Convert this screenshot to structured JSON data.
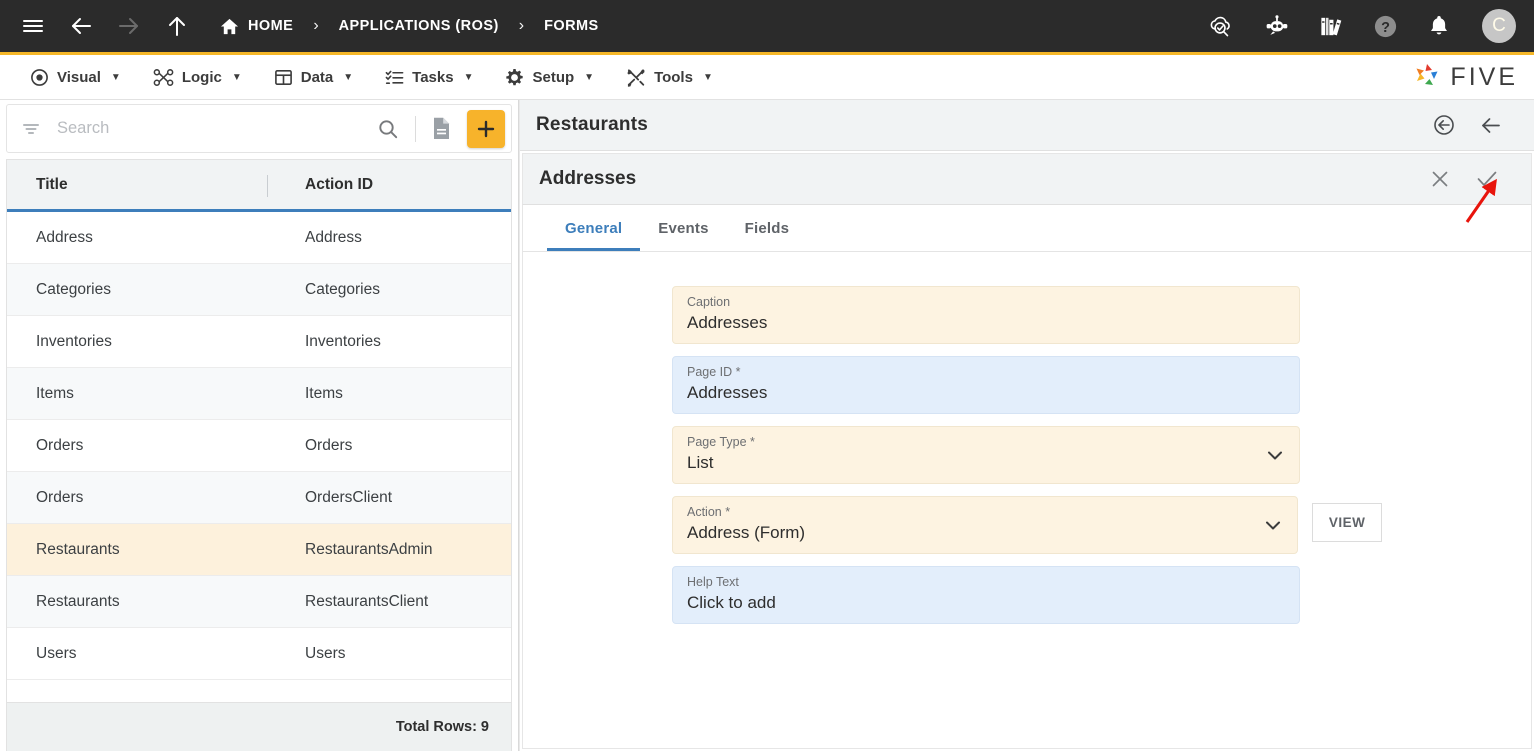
{
  "topbar": {
    "menu_icon": "hamburger-icon",
    "back_icon": "arrow-left-icon",
    "forward_icon": "arrow-right-icon",
    "up_icon": "arrow-up-icon",
    "breadcrumb": [
      {
        "label": "HOME",
        "icon": "home-icon"
      },
      {
        "label": "APPLICATIONS (ROS)",
        "icon": ""
      },
      {
        "label": "FORMS",
        "icon": ""
      }
    ],
    "separator": "›",
    "right_icons": [
      {
        "name": "cloud-check-search-icon"
      },
      {
        "name": "robot-chat-icon"
      },
      {
        "name": "books-library-icon"
      },
      {
        "name": "help-icon"
      },
      {
        "name": "notifications-bell-icon"
      }
    ],
    "avatar_letter": "C",
    "accent_color": "#f5b728",
    "background_color": "#2b2b2b"
  },
  "menubar": {
    "items": [
      {
        "label": "Visual",
        "icon": "eye-icon"
      },
      {
        "label": "Logic",
        "icon": "flow-nodes-icon"
      },
      {
        "label": "Data",
        "icon": "table-grid-icon"
      },
      {
        "label": "Tasks",
        "icon": "task-list-icon"
      },
      {
        "label": "Setup",
        "icon": "gear-icon"
      },
      {
        "label": "Tools",
        "icon": "tools-crossed-icon"
      }
    ],
    "caret": "▼",
    "logo_text": "FIVE"
  },
  "left_panel": {
    "search": {
      "placeholder": "Search",
      "value": "",
      "filter_icon": "filter-icon",
      "search_icon": "search-icon",
      "document_icon": "document-icon",
      "add_label": "+",
      "add_color": "#f7b32b"
    },
    "grid": {
      "columns": [
        "Title",
        "Action ID"
      ],
      "rows": [
        {
          "title": "Address",
          "action_id": "Address",
          "selected": false
        },
        {
          "title": "Categories",
          "action_id": "Categories",
          "selected": false
        },
        {
          "title": "Inventories",
          "action_id": "Inventories",
          "selected": false
        },
        {
          "title": "Items",
          "action_id": "Items",
          "selected": false
        },
        {
          "title": "Orders",
          "action_id": "Orders",
          "selected": false
        },
        {
          "title": "Orders",
          "action_id": "OrdersClient",
          "selected": false
        },
        {
          "title": "Restaurants",
          "action_id": "RestaurantsAdmin",
          "selected": true
        },
        {
          "title": "Restaurants",
          "action_id": "RestaurantsClient",
          "selected": false
        },
        {
          "title": "Users",
          "action_id": "Users",
          "selected": false
        }
      ],
      "footer": "Total Rows: 9",
      "header_underline_color": "#3d7ebb",
      "selected_row_color": "#fdf1dc"
    }
  },
  "right_panel": {
    "title": "Restaurants",
    "title_icons": [
      {
        "name": "revert-circle-icon"
      },
      {
        "name": "back-arrow-icon"
      }
    ],
    "sub_title": "Addresses",
    "sub_icons": [
      {
        "name": "close-icon",
        "glyph": "✕"
      },
      {
        "name": "confirm-check-icon",
        "glyph": "✓"
      }
    ],
    "tabs": [
      {
        "label": "General",
        "active": true
      },
      {
        "label": "Events",
        "active": false
      },
      {
        "label": "Fields",
        "active": false
      }
    ],
    "fields": [
      {
        "label": "Caption",
        "required": false,
        "value": "Addresses",
        "style": "cream",
        "dropdown": false,
        "button": null
      },
      {
        "label": "Page ID",
        "required": true,
        "value": "Addresses",
        "style": "blue",
        "dropdown": false,
        "button": null
      },
      {
        "label": "Page Type",
        "required": true,
        "value": "List",
        "style": "cream",
        "dropdown": true,
        "button": null
      },
      {
        "label": "Action",
        "required": true,
        "value": "Address (Form)",
        "style": "cream",
        "dropdown": true,
        "button": "VIEW"
      },
      {
        "label": "Help Text",
        "required": false,
        "value": "Click to add",
        "style": "blue",
        "dropdown": false,
        "button": null
      }
    ],
    "required_marker": "*",
    "active_tab_color": "#3d7ebb"
  },
  "annotation": {
    "type": "arrow",
    "color": "#e8140c",
    "points_at": "confirm-check-icon"
  }
}
